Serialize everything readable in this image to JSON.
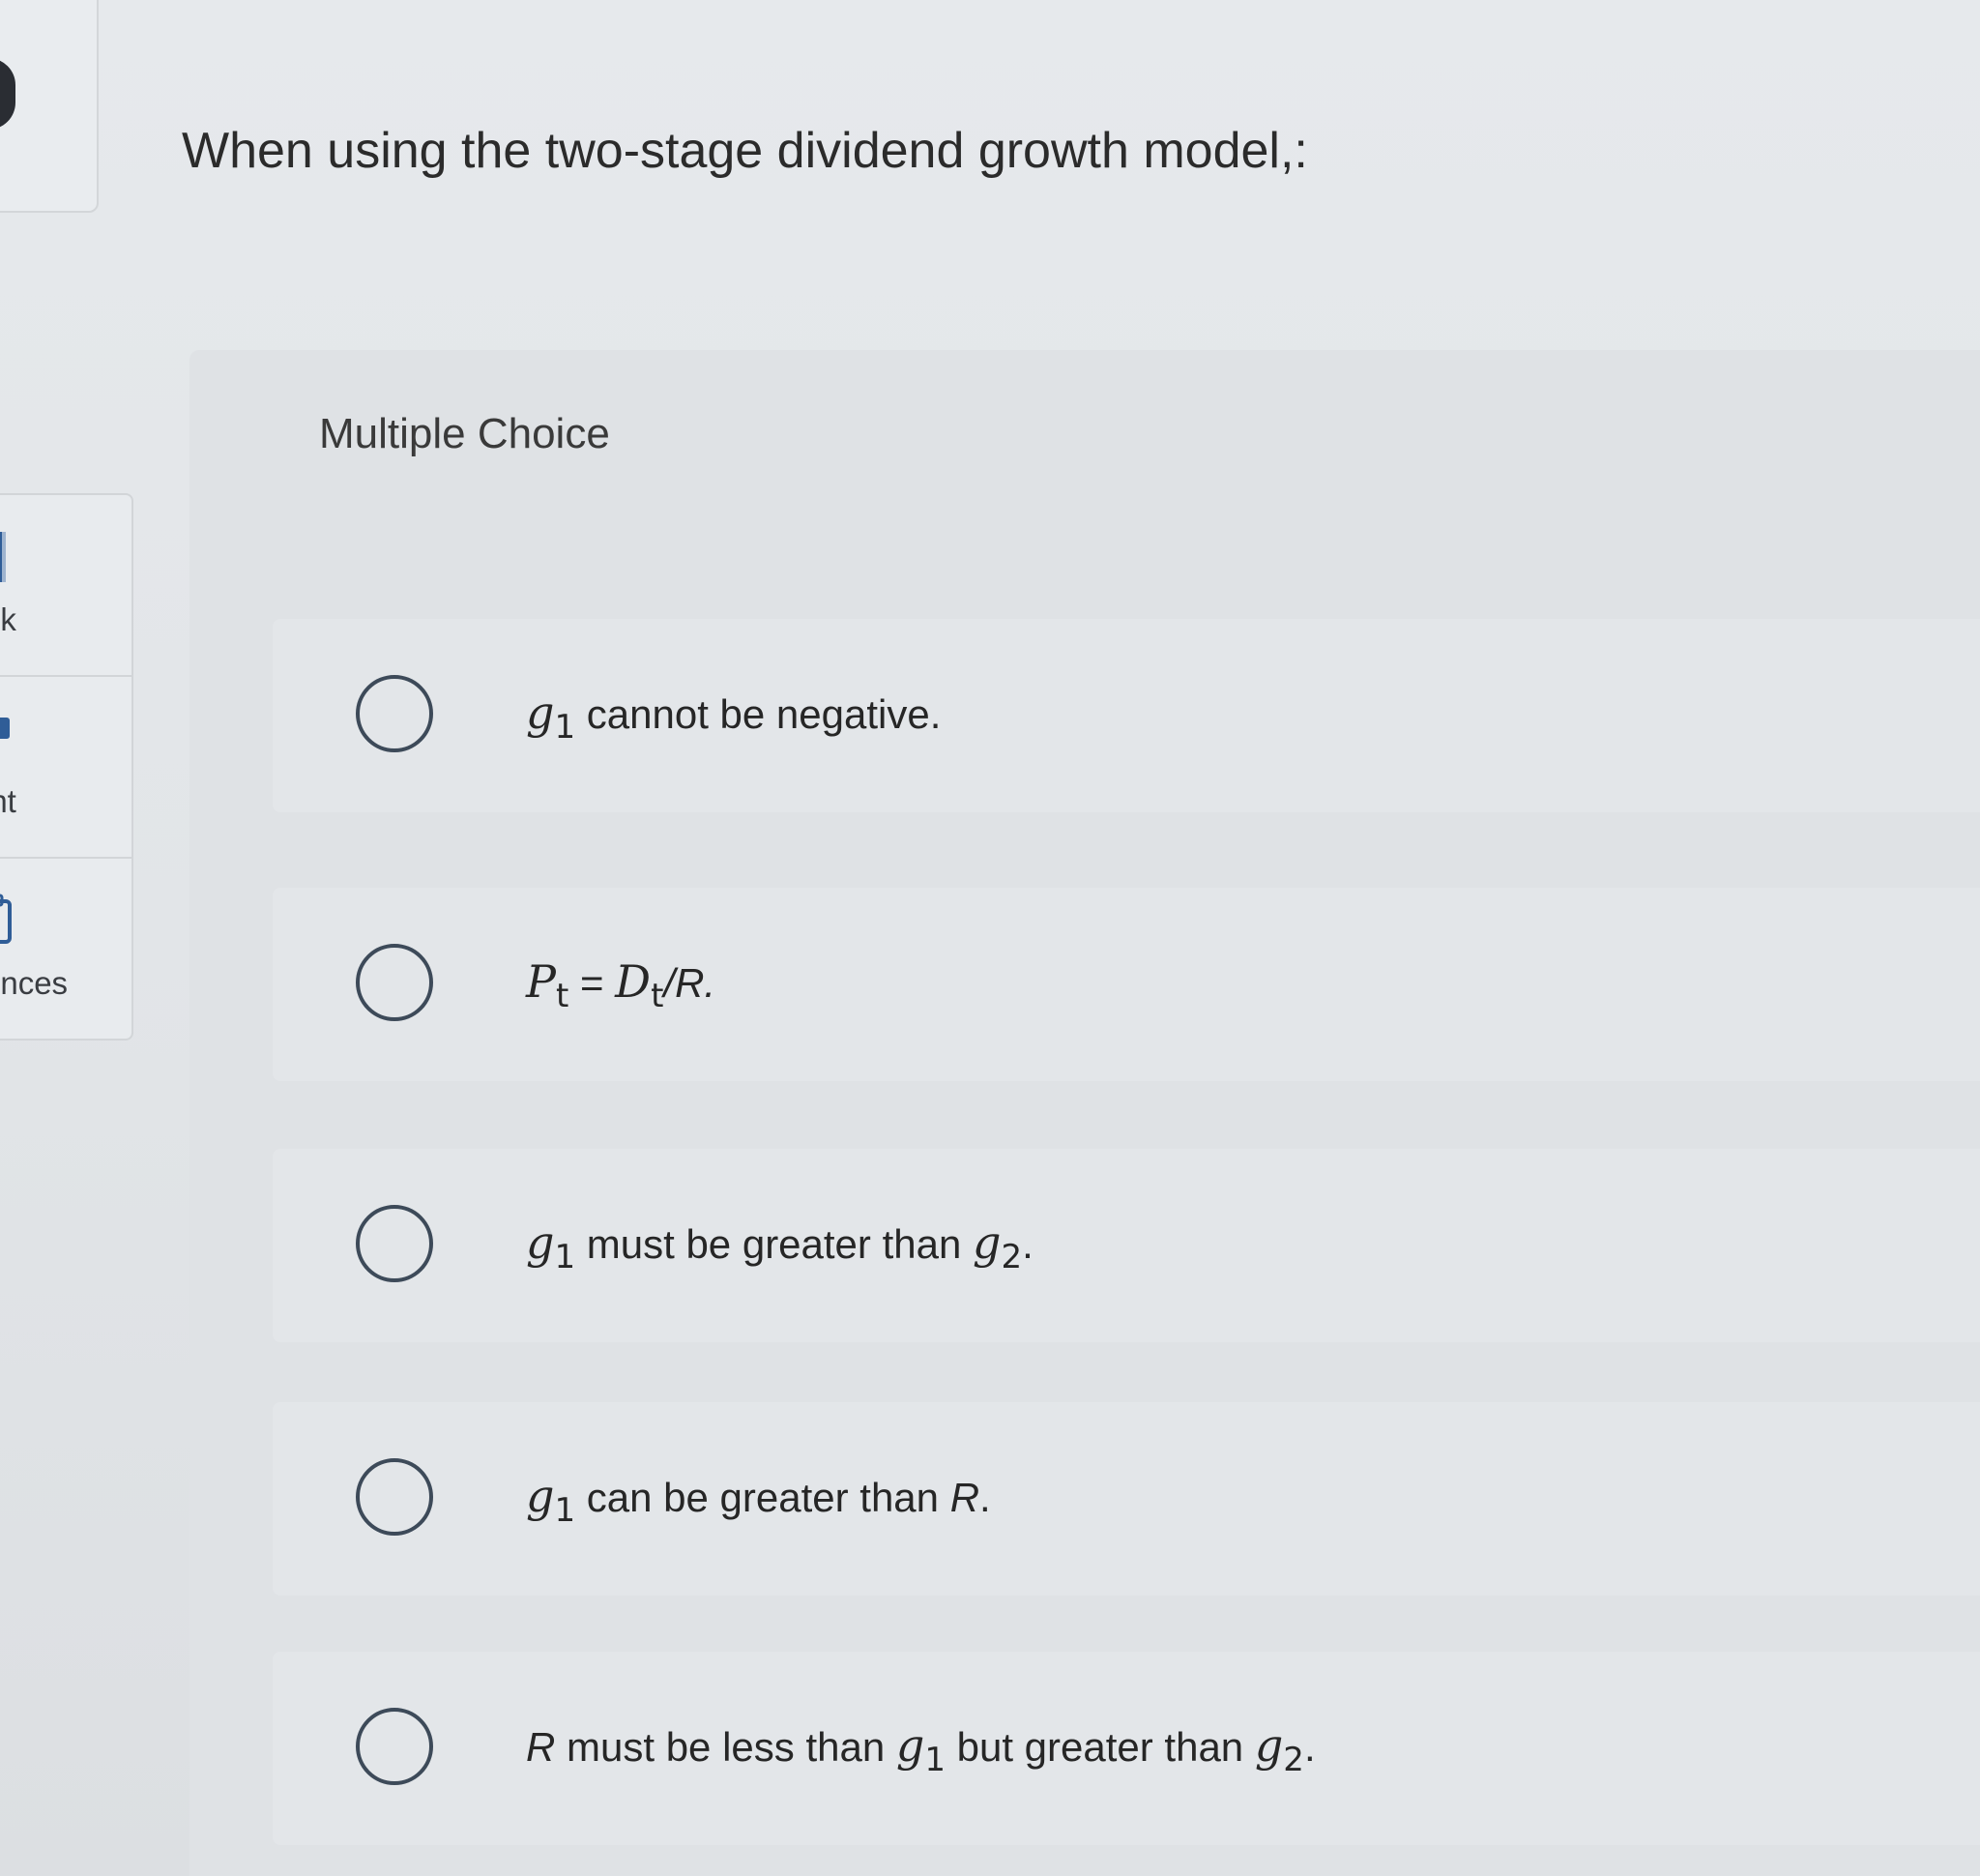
{
  "sidebar": {
    "items": [
      {
        "label": "ok",
        "icon": "book-icon"
      },
      {
        "label": "int",
        "icon": "print-icon"
      },
      {
        "label": "ences",
        "icon": "references-icon"
      }
    ]
  },
  "question": {
    "text": "When using the two-stage dividend growth model,:"
  },
  "panel": {
    "label": "Multiple Choice"
  },
  "options": [
    {
      "var": "g",
      "sub": "1",
      "text": " cannot be negative."
    },
    {
      "p_var": "P",
      "p_sub": "t",
      "eq": " = ",
      "d_var": "D",
      "d_sub": "t",
      "tail": "/R."
    },
    {
      "var": "g",
      "sub": "1",
      "text": " must be greater than ",
      "var2": "g",
      "sub2": "2",
      "end": "."
    },
    {
      "var": "g",
      "sub": "1",
      "text": " can be greater than ",
      "r": "R",
      "end": "."
    },
    {
      "r": "R",
      "text": " must be less than ",
      "var": "g",
      "sub": "1",
      "mid": " but greater than ",
      "var2": "g",
      "sub2": "2",
      "end": "."
    }
  ]
}
